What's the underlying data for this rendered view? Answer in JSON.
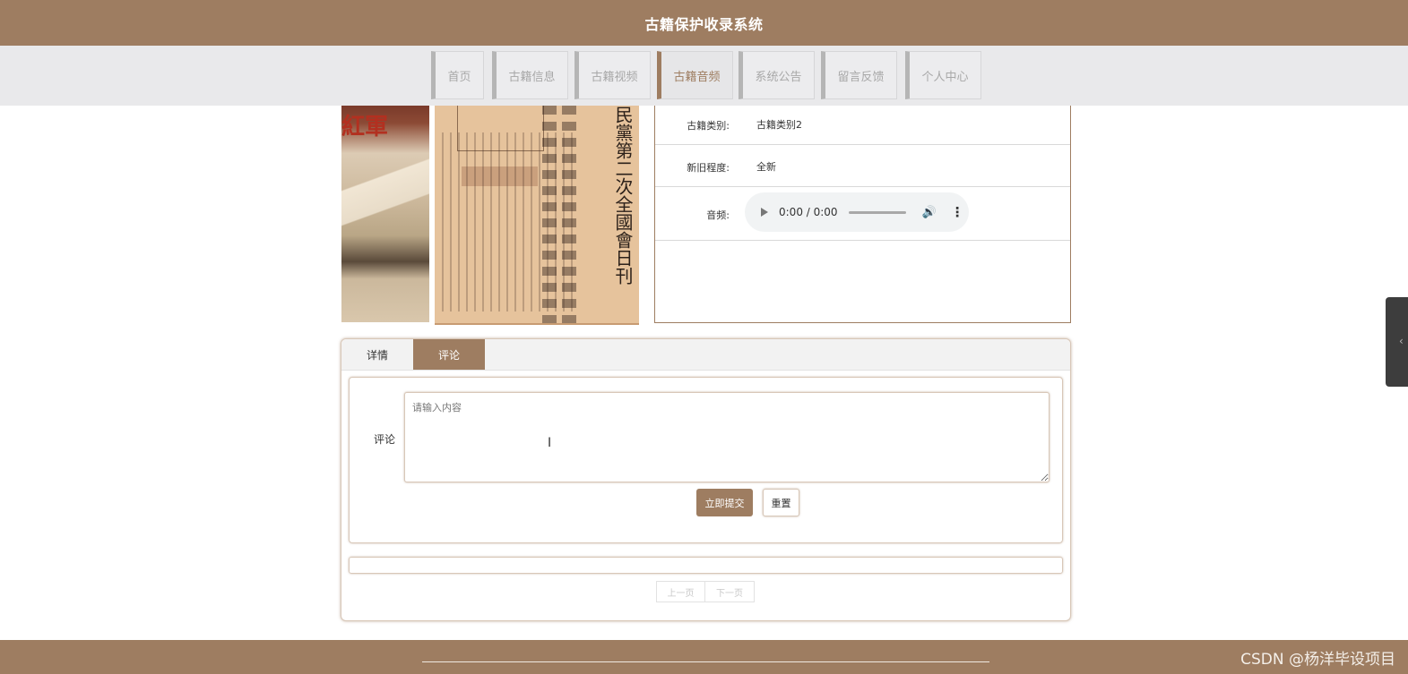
{
  "app": {
    "title": "古籍保护收录系统"
  },
  "nav": {
    "items": [
      {
        "label": "首页"
      },
      {
        "label": "古籍信息"
      },
      {
        "label": "古籍视频"
      },
      {
        "label": "古籍音频",
        "active": true
      },
      {
        "label": "系统公告"
      },
      {
        "label": "留言反馈"
      },
      {
        "label": "个人中心"
      }
    ]
  },
  "images": {
    "left_cover_text": "紅軍",
    "right_column_text": "民黨第二次全國會日刊"
  },
  "details": {
    "category_label": "古籍类别:",
    "category_value": "古籍类别2",
    "condition_label": "新旧程度:",
    "condition_value": "全新",
    "audio_label": "音频:",
    "audio_time": "0:00 / 0:00"
  },
  "tabs": [
    {
      "label": "详情"
    },
    {
      "label": "评论",
      "active": true
    }
  ],
  "comment_form": {
    "label": "评论",
    "placeholder": "请输入内容",
    "value": "",
    "submit_label": "立即提交",
    "reset_label": "重置"
  },
  "pagination": {
    "prev_label": "上一页",
    "next_label": "下一页"
  },
  "footer": {
    "watermark": "CSDN @杨洋毕设项目"
  },
  "colors": {
    "brand": "#9e7d61",
    "nav_bg": "#e9e9eb"
  },
  "icons": [
    "play-icon",
    "volume-icon",
    "more-vert-icon",
    "chevron-left-icon",
    "text-cursor-icon"
  ]
}
